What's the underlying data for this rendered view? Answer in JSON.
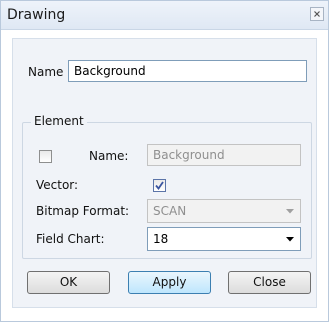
{
  "window": {
    "title": "Drawing"
  },
  "name_field": {
    "label": "Name",
    "value": "Background"
  },
  "element_group": {
    "legend": "Element",
    "name_label": "Name:",
    "name_value": "Background",
    "vector_label": "Vector:",
    "bitmap_format_label": "Bitmap Format:",
    "bitmap_format_value": "SCAN",
    "field_chart_label": "Field Chart:",
    "field_chart_value": "18"
  },
  "buttons": {
    "ok": "OK",
    "apply": "Apply",
    "close": "Close"
  },
  "state": {
    "name_checkbox_checked": false,
    "vector_checked": true
  },
  "colors": {
    "title_bg": "#dfe8f4",
    "panel_bg": "#f0f3f8",
    "check_mark": "#3a55a0",
    "default_button": "#bee6fd"
  }
}
